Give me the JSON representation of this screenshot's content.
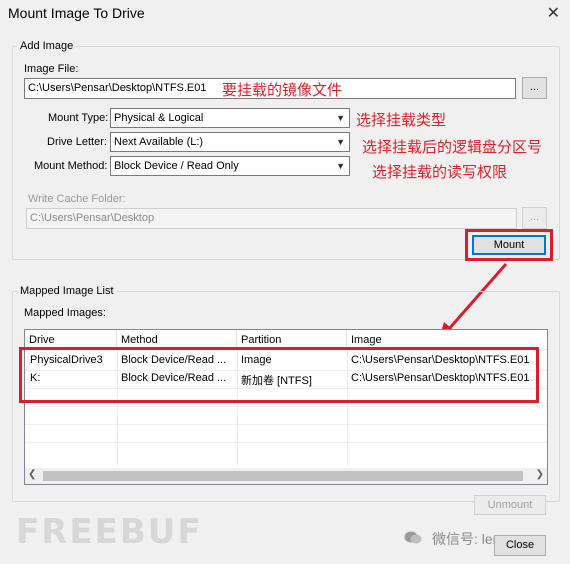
{
  "window": {
    "title": "Mount Image To Drive"
  },
  "add_image": {
    "group_label": "Add Image",
    "image_file_label": "Image File:",
    "image_file_value": "C:\\Users\\Pensar\\Desktop\\NTFS.E01",
    "browse_label": "...",
    "mount_type_label": "Mount Type:",
    "mount_type_value": "Physical & Logical",
    "drive_letter_label": "Drive Letter:",
    "drive_letter_value": "Next Available (L:)",
    "mount_method_label": "Mount Method:",
    "mount_method_value": "Block Device / Read Only",
    "write_cache_label": "Write Cache Folder:",
    "write_cache_value": "C:\\Users\\Pensar\\Desktop",
    "write_cache_browse_label": "...",
    "mount_button": "Mount"
  },
  "annotations": {
    "image_file": "要挂载的镜像文件",
    "mount_type": "选择挂载类型",
    "drive_letter": "选择挂载后的逻辑盘分区号",
    "mount_method": "选择挂载的读写权限"
  },
  "mapped": {
    "group_label": "Mapped Image List",
    "list_label": "Mapped Images:",
    "columns": [
      "Drive",
      "Method",
      "Partition",
      "Image"
    ],
    "rows": [
      [
        "PhysicalDrive3",
        "Block Device/Read ...",
        "Image",
        "C:\\Users\\Pensar\\Desktop\\NTFS.E01"
      ],
      [
        "K:",
        "Block Device/Read ...",
        "新加卷 [NTFS]",
        "C:\\Users\\Pensar\\Desktop\\NTFS.E01"
      ]
    ],
    "unmount_button": "Unmount"
  },
  "footer": {
    "close_button": "Close",
    "watermark_left": "FREEBUF",
    "watermark_right": "微信号: lemon-sec"
  },
  "colors": {
    "annotation": "#e0222a",
    "focus": "#0078d7"
  }
}
